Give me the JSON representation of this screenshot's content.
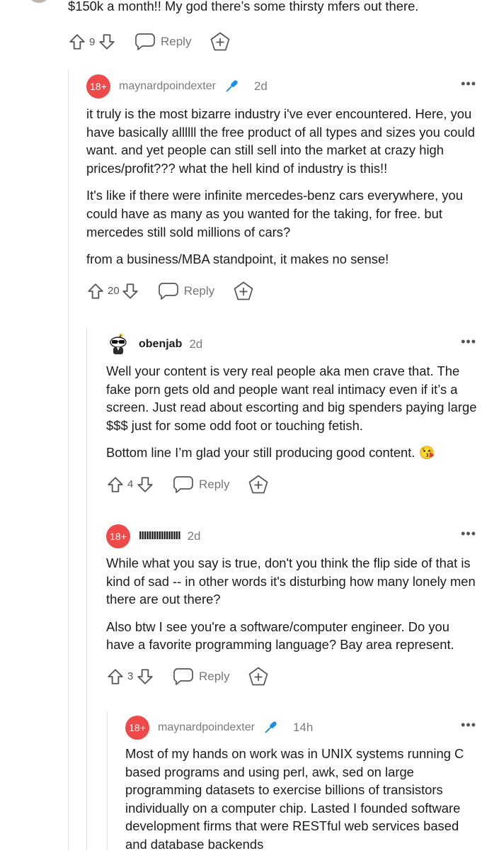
{
  "top_comment": {
    "text_tail": "$150k a month!! My god there’s some thirsty mfers out there.",
    "score": "9",
    "reply_label": "Reply"
  },
  "comments": [
    {
      "username": "maynardpoindexter",
      "avatar_badge": "18+",
      "time": "2d",
      "paragraphs": [
        "it truly is the most bizarre industry i've ever encountered. Here, you have basically allllll the free product of all types and sizes you could want. and yet people can still sell into the market at crazy high prices/profit??? what the hell kind of industry is this!!",
        "It's like if there were infinite mercedes-benz cars everywhere, you could have as many as you wanted for the taking, for free. but mercedes still sold millions of cars?",
        "from a business/MBA standpoint, it makes no sense!"
      ],
      "score": "20",
      "reply_label": "Reply"
    },
    {
      "username": "obenjab",
      "time": "2d",
      "paragraphs": [
        "Well your content is very real people aka men crave that. The fake porn gets old and people want real intimacy even if it’s a screen. Just read about escorting and big spenders paying large $$$ just for some odd foot or touching fetish.",
        "Bottom line I’m glad your still producing good content. 😘"
      ],
      "score": "4",
      "reply_label": "Reply"
    },
    {
      "username": "IIIIIIIIIIIIIIIII",
      "avatar_badge": "18+",
      "time": "2d",
      "paragraphs": [
        "While what you say is true, don't you think the flip side of that is kind of sad -- in other words it's disturbing how many lonely men there are out there?",
        "Also btw I see you're a software/computer engineer. Do you have a favorite programming language? Bay area represent."
      ],
      "score": "3",
      "reply_label": "Reply"
    },
    {
      "username": "maynardpoindexter",
      "avatar_badge": "18+",
      "time": "14h",
      "paragraphs": [
        "Most of my hands on work was in UNIX systems running C based programs and using perl, awk, sed on large programming datasets to exercise billions of transistors individually on a computer chip. Lasted I founded software development firms that were RESTful web services based and database backends"
      ]
    }
  ],
  "more_label": "•••",
  "icons": {
    "upvote": "upvote-arrow-icon",
    "downvote": "downvote-arrow-icon",
    "reply": "speech-bubble-icon",
    "award": "plus-pentagon-icon",
    "flair": "microphone-icon",
    "snoo": "snoo-avatar-icon"
  },
  "colors": {
    "avatar_badge": "#ef4a4a",
    "flair": "#1a8fe3",
    "meta_gray": "#7c7c7c",
    "thread_line": "#e3e3e3"
  }
}
